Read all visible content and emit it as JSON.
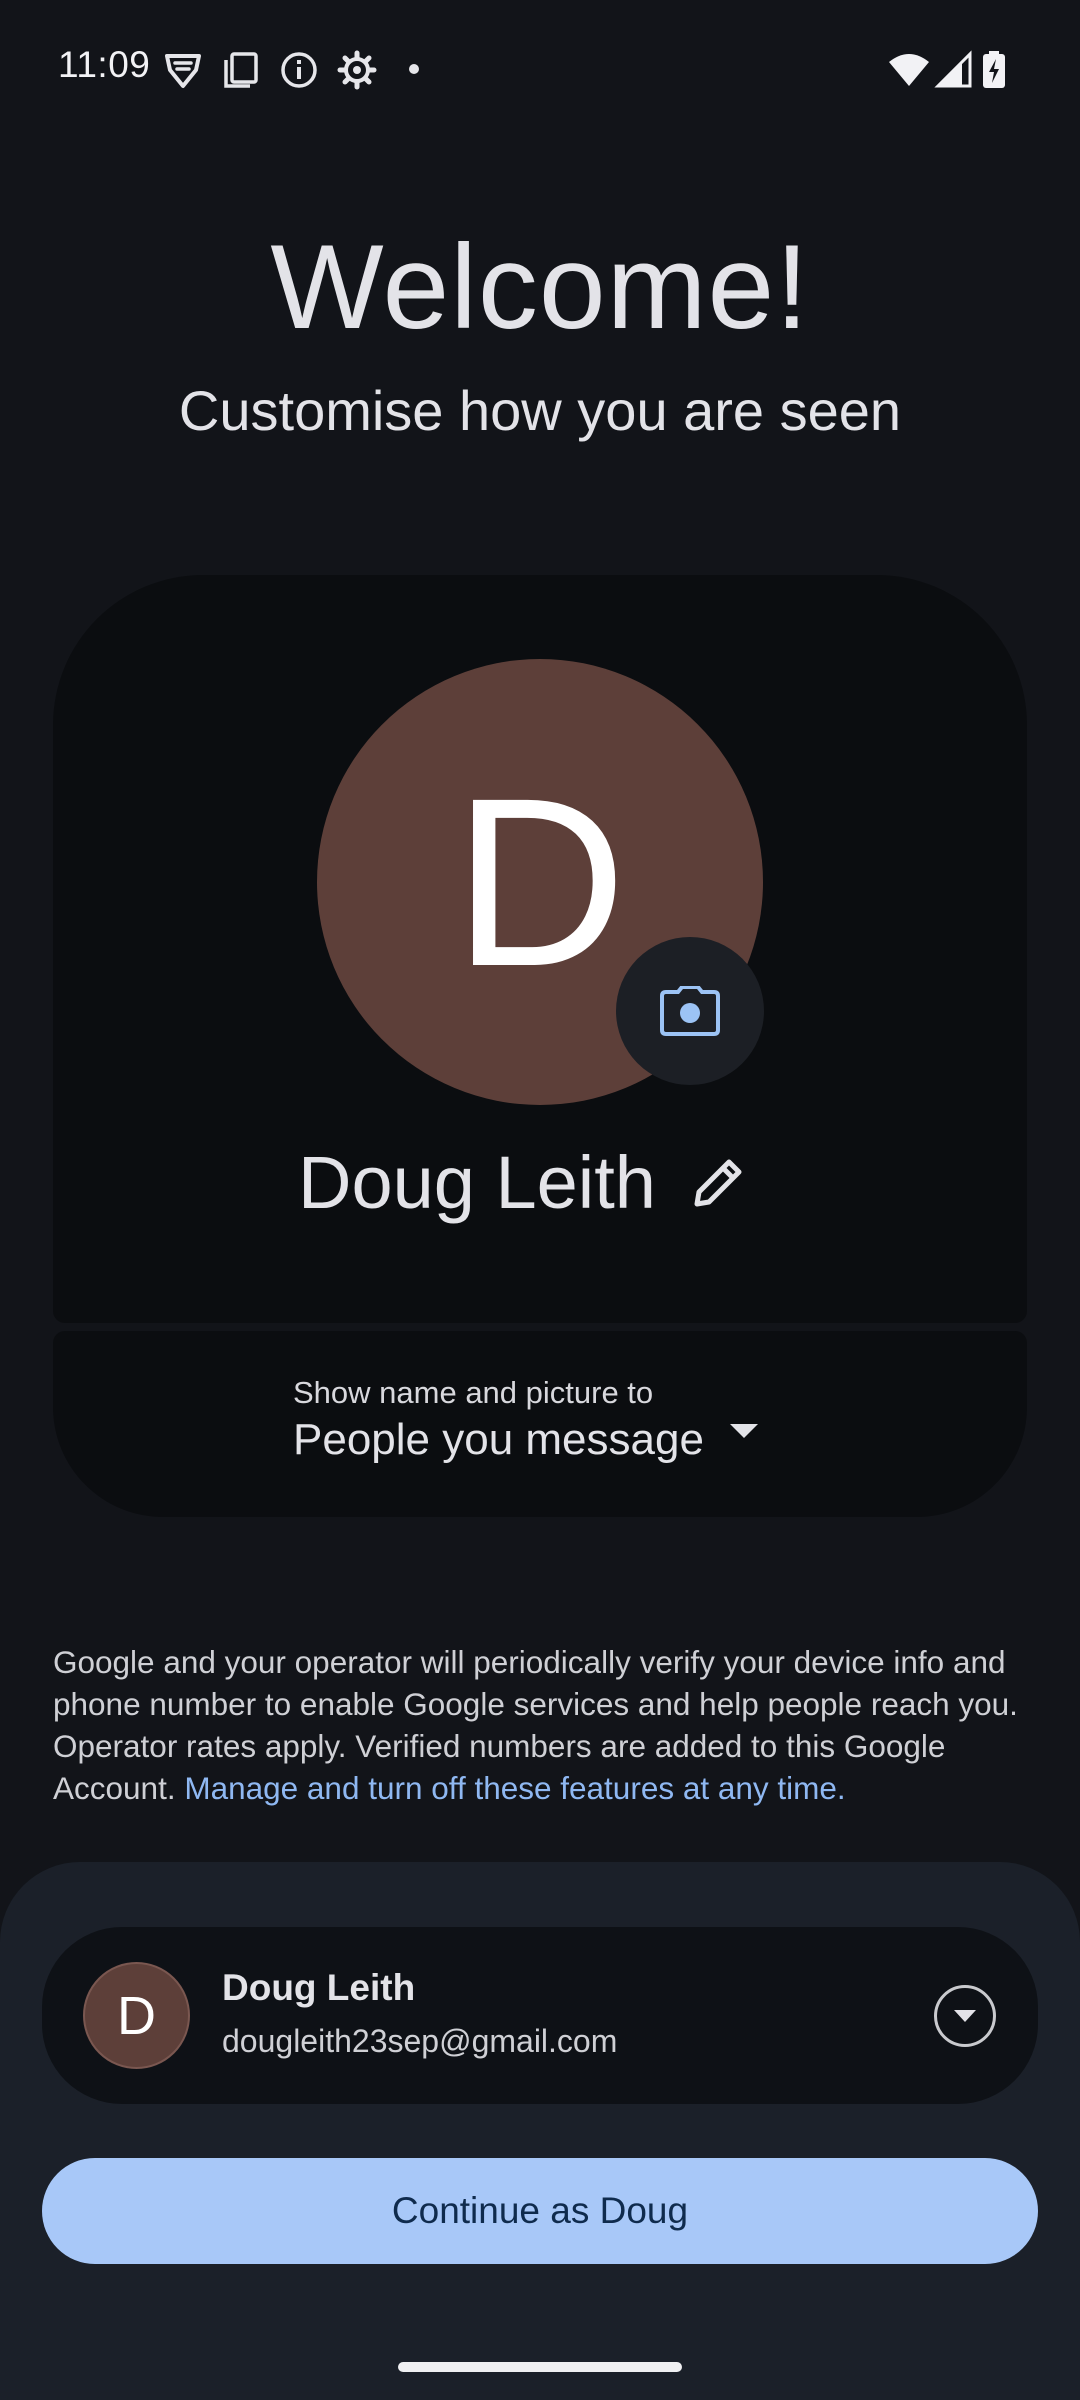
{
  "status_bar": {
    "time": "11:09",
    "icons": [
      "vpn-shield-icon",
      "copy-icon",
      "info-icon",
      "settings-icon",
      "notification-dot",
      "wifi-icon",
      "cell-signal-icon",
      "battery-charging-icon"
    ]
  },
  "header": {
    "title": "Welcome!",
    "subtitle": "Customise how you are seen"
  },
  "profile": {
    "avatar_initial": "D",
    "avatar_color": "#5d3f39",
    "name": "Doug Leith",
    "camera_icon": "camera-icon",
    "edit_icon": "pencil-icon",
    "visibility_label": "Show name and picture to",
    "visibility_value": "People you message"
  },
  "disclaimer": {
    "text": "Google and your operator will periodically verify your device info and phone number to enable Google services and help people reach you. Operator rates apply. Verified numbers are added to this Google Account. ",
    "link": "Manage and turn off these features at any time."
  },
  "account": {
    "initial": "D",
    "name": "Doug Leith",
    "email": "dougleith23sep@gmail.com"
  },
  "actions": {
    "continue_label": "Continue as Doug"
  },
  "colors": {
    "background": "#121419",
    "sheet": "#1b2029",
    "accent_button": "#a8c8f8",
    "link": "#8fb8f2",
    "camera_icon": "#9cc3f5"
  }
}
